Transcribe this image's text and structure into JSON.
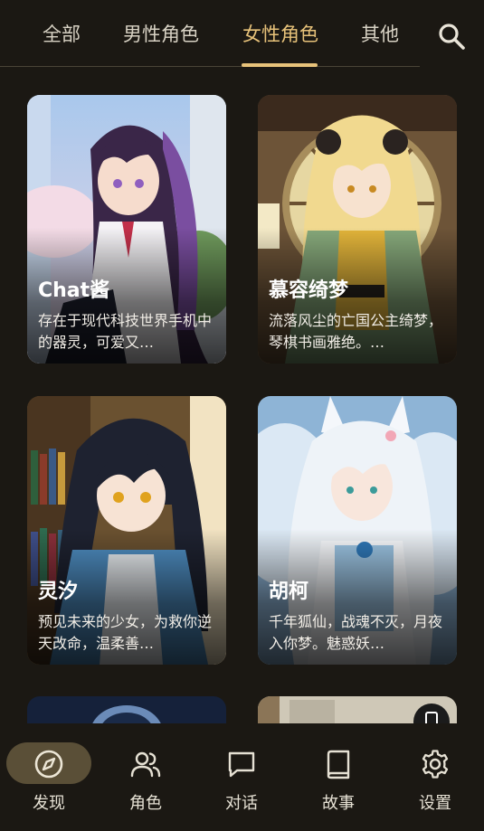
{
  "tabs": [
    {
      "label": "全部",
      "active": false
    },
    {
      "label": "男性角色",
      "active": false
    },
    {
      "label": "女性角色",
      "active": true
    },
    {
      "label": "其他",
      "active": false
    }
  ],
  "search_icon": "search-icon",
  "cards": [
    {
      "name": "Chat酱",
      "desc": "存在于现代科技世界手机中的器灵，可爱又…"
    },
    {
      "name": "慕容绮梦",
      "desc": "流落风尘的亡国公主绮梦，琴棋书画雅绝。…"
    },
    {
      "name": "灵汐",
      "desc": "预见未来的少女，为救你逆天改命，温柔善…"
    },
    {
      "name": "胡柯",
      "desc": "千年狐仙，战魂不灭，月夜入你梦。魅惑妖…"
    }
  ],
  "nav": [
    {
      "label": "发现",
      "icon": "compass-icon",
      "active": true
    },
    {
      "label": "角色",
      "icon": "users-icon",
      "active": false
    },
    {
      "label": "对话",
      "icon": "chat-bubble-icon",
      "active": false
    },
    {
      "label": "故事",
      "icon": "book-icon",
      "active": false
    },
    {
      "label": "设置",
      "icon": "gear-icon",
      "active": false
    }
  ],
  "colors": {
    "accent": "#e7c27a",
    "background": "#1b1813",
    "active_pill": "#5a4f37"
  }
}
